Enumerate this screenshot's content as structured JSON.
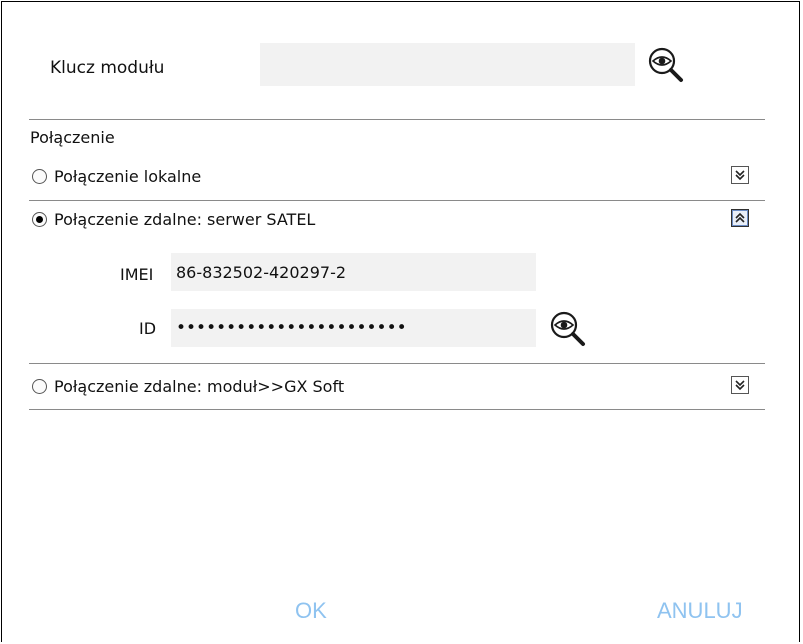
{
  "module_key": {
    "label": "Klucz modułu",
    "value": "",
    "reveal_icon": "eye-magnifier-icon"
  },
  "connection": {
    "section_title": "Połączenie",
    "options": [
      {
        "label": "Połączenie lokalne",
        "selected": false,
        "expanded": false
      },
      {
        "label": "Połączenie zdalne: serwer SATEL",
        "selected": true,
        "expanded": true
      },
      {
        "label": "Połączenie zdalne: moduł>>GX Soft",
        "selected": false,
        "expanded": false
      }
    ],
    "satel_server": {
      "imei_label": "IMEI",
      "imei_value": "86-832502-420297-2",
      "id_label": "ID",
      "id_value": "•••••••••••••••••••••••",
      "reveal_icon": "eye-magnifier-icon"
    }
  },
  "actions": {
    "ok_label": "OK",
    "cancel_label": "ANULUJ"
  },
  "colors": {
    "button_text": "#8fc3f0",
    "field_background": "#f2f2f2",
    "divider": "#8a8a8a"
  }
}
